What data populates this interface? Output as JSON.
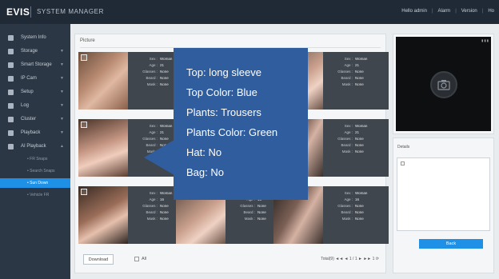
{
  "header": {
    "logo": "EVIS",
    "title": "SYSTEM MANAGER",
    "links": [
      "Hello admin",
      "Alarm",
      "Version",
      "Ho"
    ]
  },
  "sidebar": {
    "items": [
      {
        "label": "System Info",
        "icon": "info-icon"
      },
      {
        "label": "Storage",
        "icon": "storage-icon"
      },
      {
        "label": "Smart Storage",
        "icon": "smart-storage-icon"
      },
      {
        "label": "IP Cam",
        "icon": "camera-icon"
      },
      {
        "label": "Setup",
        "icon": "gear-icon"
      },
      {
        "label": "Log",
        "icon": "log-icon"
      },
      {
        "label": "Cluster",
        "icon": "cluster-icon"
      },
      {
        "label": "Playback",
        "icon": "playback-icon"
      },
      {
        "label": "AI Playback",
        "icon": "ai-playback-icon"
      }
    ],
    "subitems": [
      {
        "label": "• FR Snaps",
        "active": false
      },
      {
        "label": "• Search Snaps",
        "active": false
      },
      {
        "label": "• Sun Down",
        "active": true
      },
      {
        "label": "• Vehicle FR",
        "active": false
      }
    ]
  },
  "main": {
    "title": "Picture",
    "attr_keys": [
      "Sex :",
      "Age :",
      "Glasses :",
      "Beard :",
      "Mask :"
    ],
    "cards": [
      {
        "values": [
          "Woman",
          "21",
          "None",
          "None",
          "None"
        ]
      },
      {
        "values": [
          "Woman",
          "21",
          "None",
          "None",
          "None"
        ]
      },
      {
        "values": [
          "Woman",
          "21",
          "None",
          "None",
          "None"
        ]
      },
      {
        "values": [
          "Woman",
          "21",
          "None",
          "None",
          "None"
        ]
      },
      {
        "values": [
          "Woman",
          "16",
          "None",
          "None",
          "None"
        ]
      },
      {
        "values": [
          "Woman",
          "16",
          "None",
          "None",
          "None"
        ]
      },
      {
        "values": [
          "Woman",
          "16",
          "None",
          "None",
          "None"
        ]
      }
    ],
    "download_label": "Download",
    "all_label": "All",
    "pager_text": "Total(9) ◄◄ ◄ 1 / 1 ► ►► 1 ⟳"
  },
  "details": {
    "title": "Details",
    "back_label": "Back"
  },
  "callout": {
    "lines": [
      "Top: long sleeve",
      "Top Color: Blue",
      "Plants: Trousers",
      "Plants Color: Green",
      "Hat: No",
      "Bag: No"
    ]
  },
  "colors": {
    "accent": "#1e90e6",
    "callout": "#2f5d9d",
    "sidebar": "#2b3744",
    "topbar": "#1f2a36"
  }
}
